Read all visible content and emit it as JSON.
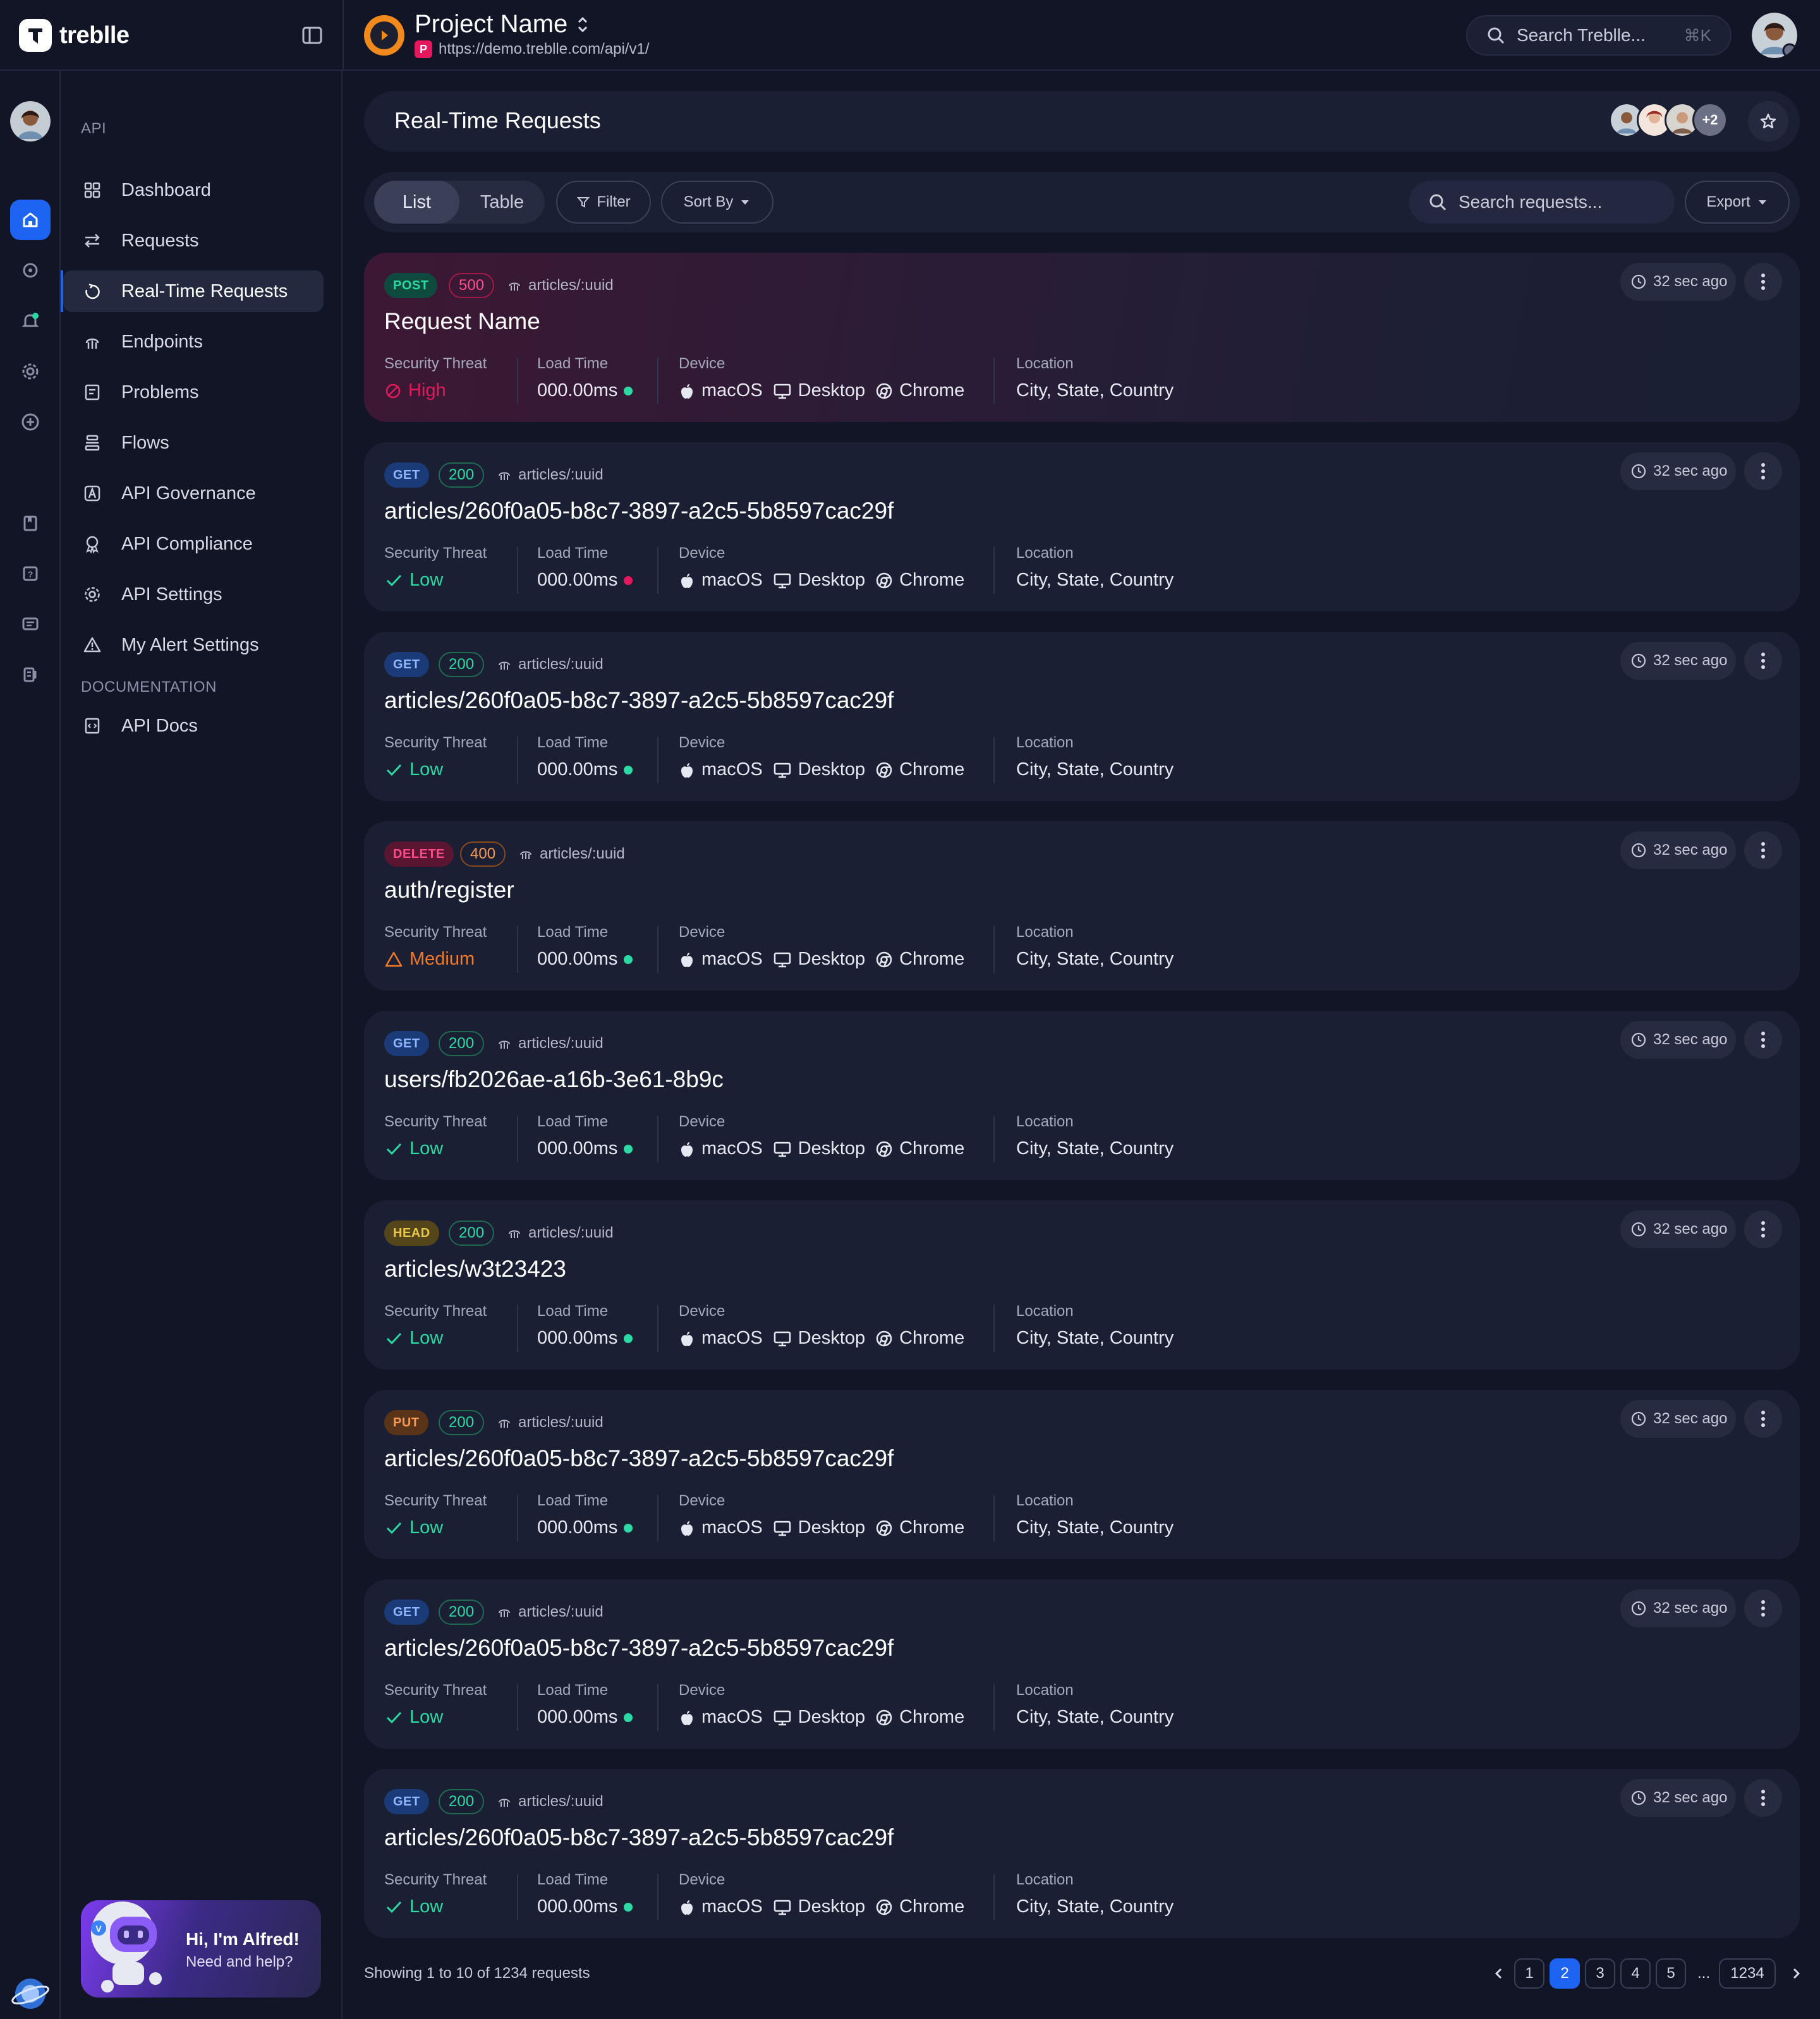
{
  "brand": {
    "name": "treblle"
  },
  "project": {
    "name": "Project Name",
    "url": "https://demo.treblle.com/api/v1/",
    "badge": "P"
  },
  "global_search": {
    "placeholder": "Search Treblle...",
    "shortcut": "⌘K"
  },
  "sidebar": {
    "api_label": "API",
    "items": [
      {
        "label": "Dashboard",
        "icon": "dashboard-icon"
      },
      {
        "label": "Requests",
        "icon": "arrows-icon"
      },
      {
        "label": "Real-Time Requests",
        "icon": "realtime-icon"
      },
      {
        "label": "Endpoints",
        "icon": "endpoints-icon"
      },
      {
        "label": "Problems",
        "icon": "problems-icon"
      },
      {
        "label": "Flows",
        "icon": "flows-icon"
      },
      {
        "label": "API Governance",
        "icon": "governance-icon"
      },
      {
        "label": "API Compliance",
        "icon": "compliance-icon"
      },
      {
        "label": "API Settings",
        "icon": "gear-icon"
      },
      {
        "label": "My Alert Settings",
        "icon": "alert-icon"
      }
    ],
    "docs_label": "DOCUMENTATION",
    "docs_items": [
      {
        "label": "API Docs",
        "icon": "api-docs-icon"
      }
    ],
    "active_item": "Real-Time Requests"
  },
  "alfred": {
    "title": "Hi, I'm Alfred!",
    "subtitle": "Need and help?"
  },
  "page": {
    "title": "Real-Time Requests",
    "collaborators_more": "+2"
  },
  "toolbar": {
    "view_list": "List",
    "view_table": "Table",
    "active_view": "List",
    "filter": "Filter",
    "sort": "Sort By",
    "search_placeholder": "Search requests...",
    "export": "Export"
  },
  "labels": {
    "security": "Security Threat",
    "load": "Load Time",
    "device": "Device",
    "location": "Location"
  },
  "colors": {
    "accent": "#1d64f2",
    "low": "#2bd9a3",
    "high": "#e5175d",
    "medium": "#f07a2a"
  },
  "requests": [
    {
      "method": "POST",
      "status": "500",
      "path": "articles/:uuid",
      "name": "Request Name",
      "threat": "High",
      "threat_level": "high",
      "load": "000.00ms",
      "load_ok": false,
      "load_dot": "ok",
      "os": "macOS",
      "device": "Desktop",
      "browser": "Chrome",
      "location": "City, State, Country",
      "time": "32 sec ago"
    },
    {
      "method": "GET",
      "status": "200",
      "path": "articles/:uuid",
      "name": "articles/260f0a05-b8c7-3897-a2c5-5b8597cac29f",
      "threat": "Low",
      "threat_level": "low",
      "load": "000.00ms",
      "load_dot": "bad",
      "os": "macOS",
      "device": "Desktop",
      "browser": "Chrome",
      "location": "City, State, Country",
      "time": "32 sec ago"
    },
    {
      "method": "GET",
      "status": "200",
      "path": "articles/:uuid",
      "name": "articles/260f0a05-b8c7-3897-a2c5-5b8597cac29f",
      "threat": "Low",
      "threat_level": "low",
      "load": "000.00ms",
      "load_dot": "ok",
      "os": "macOS",
      "device": "Desktop",
      "browser": "Chrome",
      "location": "City, State, Country",
      "time": "32 sec ago"
    },
    {
      "method": "DELETE",
      "status": "400",
      "path": "articles/:uuid",
      "name": "auth/register",
      "threat": "Medium",
      "threat_level": "medium",
      "load": "000.00ms",
      "load_dot": "ok",
      "os": "macOS",
      "device": "Desktop",
      "browser": "Chrome",
      "location": "City, State, Country",
      "time": "32 sec ago"
    },
    {
      "method": "GET",
      "status": "200",
      "path": "articles/:uuid",
      "name": "users/fb2026ae-a16b-3e61-8b9c",
      "threat": "Low",
      "threat_level": "low",
      "load": "000.00ms",
      "load_dot": "ok",
      "os": "macOS",
      "device": "Desktop",
      "browser": "Chrome",
      "location": "City, State, Country",
      "time": "32 sec ago"
    },
    {
      "method": "HEAD",
      "status": "200",
      "path": "articles/:uuid",
      "name": "articles/w3t23423",
      "threat": "Low",
      "threat_level": "low",
      "load": "000.00ms",
      "load_dot": "ok",
      "os": "macOS",
      "device": "Desktop",
      "browser": "Chrome",
      "location": "City, State, Country",
      "time": "32 sec ago"
    },
    {
      "method": "PUT",
      "status": "200",
      "path": "articles/:uuid",
      "name": "articles/260f0a05-b8c7-3897-a2c5-5b8597cac29f",
      "threat": "Low",
      "threat_level": "low",
      "load": "000.00ms",
      "load_dot": "ok",
      "os": "macOS",
      "device": "Desktop",
      "browser": "Chrome",
      "location": "City, State, Country",
      "time": "32 sec ago"
    },
    {
      "method": "GET",
      "status": "200",
      "path": "articles/:uuid",
      "name": "articles/260f0a05-b8c7-3897-a2c5-5b8597cac29f",
      "threat": "Low",
      "threat_level": "low",
      "load": "000.00ms",
      "load_dot": "ok",
      "os": "macOS",
      "device": "Desktop",
      "browser": "Chrome",
      "location": "City, State, Country",
      "time": "32 sec ago"
    },
    {
      "method": "GET",
      "status": "200",
      "path": "articles/:uuid",
      "name": "articles/260f0a05-b8c7-3897-a2c5-5b8597cac29f",
      "threat": "Low",
      "threat_level": "low",
      "load": "000.00ms",
      "load_dot": "ok",
      "os": "macOS",
      "device": "Desktop",
      "browser": "Chrome",
      "location": "City, State, Country",
      "time": "32 sec ago"
    }
  ],
  "footer": {
    "showing": "Showing 1 to 10 of 1234 requests",
    "pages": [
      "1",
      "2",
      "3",
      "4",
      "5"
    ],
    "current_page": "2",
    "ellipsis": "...",
    "last_page": "1234"
  }
}
